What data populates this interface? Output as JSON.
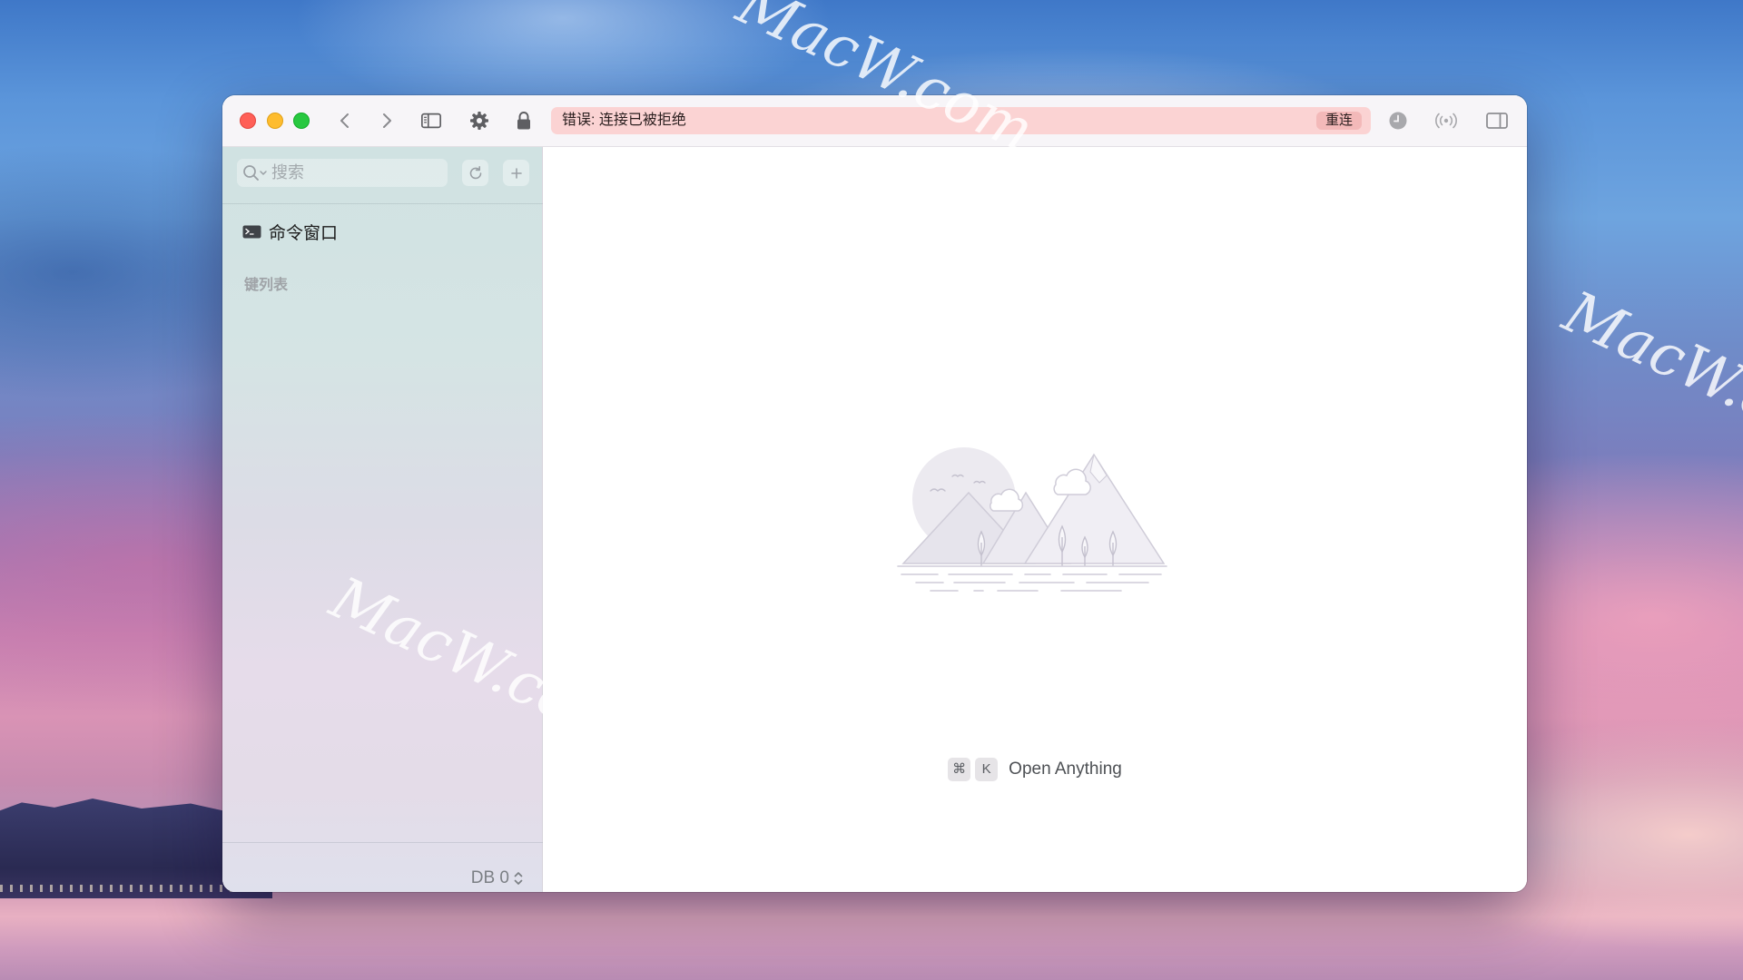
{
  "toolbar": {
    "icons": [
      "chevron-left-icon",
      "chevron-right-icon",
      "sidebar-toggle-icon",
      "gear-icon",
      "lock-icon",
      "clock-icon",
      "broadcast-icon",
      "panel-right-icon"
    ],
    "error_text": "错误: 连接已被拒绝",
    "reconnect_label": "重连"
  },
  "sidebar": {
    "search": {
      "placeholder": "搜索",
      "value": ""
    },
    "command_window_label": "命令窗口",
    "keys_section_label": "键列表",
    "db_label": "DB 0"
  },
  "main": {
    "empty_state": {
      "shortcut_keys": [
        "⌘",
        "K"
      ],
      "label": "Open Anything"
    }
  },
  "watermark_text": "MacW.com",
  "colors": {
    "error_banner": "#fbd3d3",
    "close": "#ff5f57",
    "minimize": "#febc2e",
    "zoom": "#28c840"
  }
}
